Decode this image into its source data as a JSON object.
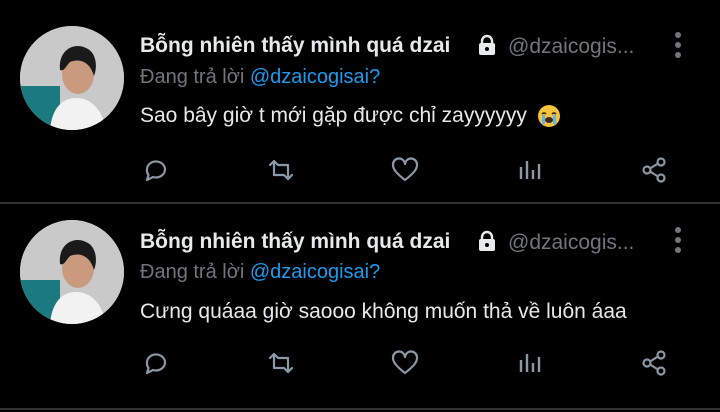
{
  "colors": {
    "background": "#000000",
    "divider": "#2f3336",
    "text_primary": "#e7e9ea",
    "text_secondary": "#71767b",
    "mention": "#1d9bf0"
  },
  "tweets": [
    {
      "display_name": "Bỗng nhiên thấy mình quá dzai",
      "handle": "@dzaicogis...",
      "reply_prefix": "Đang trả lời",
      "reply_mention": "@dzaicogisai?",
      "text": "Sao bây giờ t mới gặp được chỉ zayyyyyy",
      "emoji": "loudly-crying-face",
      "icons": [
        "lock-icon",
        "more-icon",
        "reply-icon",
        "retweet-icon",
        "like-icon",
        "views-icon",
        "share-icon"
      ]
    },
    {
      "display_name": "Bỗng nhiên thấy mình quá dzai",
      "handle": "@dzaicogis...",
      "reply_prefix": "Đang trả lời",
      "reply_mention": "@dzaicogisai?",
      "text": "Cưng quáaa giờ saooo không muốn thả về luôn áaa",
      "icons": [
        "lock-icon",
        "more-icon",
        "reply-icon",
        "retweet-icon",
        "like-icon",
        "views-icon",
        "share-icon"
      ]
    }
  ]
}
